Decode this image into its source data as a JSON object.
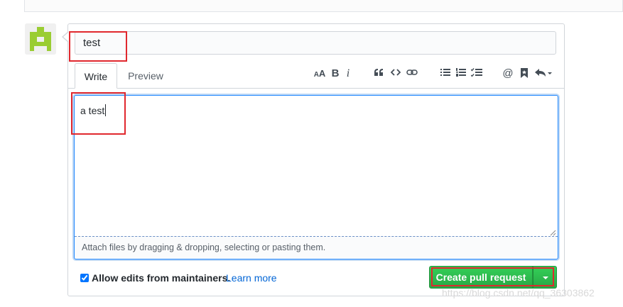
{
  "title_input": {
    "value": "test"
  },
  "tabs": [
    {
      "label": "Write",
      "active": true
    },
    {
      "label": "Preview",
      "active": false
    }
  ],
  "toolbar": {
    "items": [
      {
        "name": "header-icon",
        "glyph": "AA"
      },
      {
        "name": "bold-icon",
        "glyph": "B"
      },
      {
        "name": "italic-icon",
        "glyph": "i"
      },
      {
        "name": "quote-icon",
        "glyph": "“"
      },
      {
        "name": "code-icon",
        "glyph": "<>"
      },
      {
        "name": "link-icon",
        "glyph": ""
      },
      {
        "name": "unordered-list-icon",
        "glyph": ""
      },
      {
        "name": "ordered-list-icon",
        "glyph": ""
      },
      {
        "name": "task-list-icon",
        "glyph": ""
      },
      {
        "name": "mention-icon",
        "glyph": "@"
      },
      {
        "name": "reference-icon",
        "glyph": ""
      },
      {
        "name": "reply-icon",
        "glyph": ""
      }
    ]
  },
  "editor": {
    "value": "a test",
    "drop_hint": "Attach files by dragging & dropping, selecting or pasting them."
  },
  "footer": {
    "allow_edits_label": "Allow edits from maintainers.",
    "allow_edits_checked": true,
    "learn_more": "Learn more",
    "submit_label": "Create pull request"
  },
  "watermark": "https://blog.csdn.net/qq_36303862",
  "colors": {
    "accent_blue": "#0366d6",
    "button_green": "#28a745",
    "annotation_red": "#e0282e"
  }
}
